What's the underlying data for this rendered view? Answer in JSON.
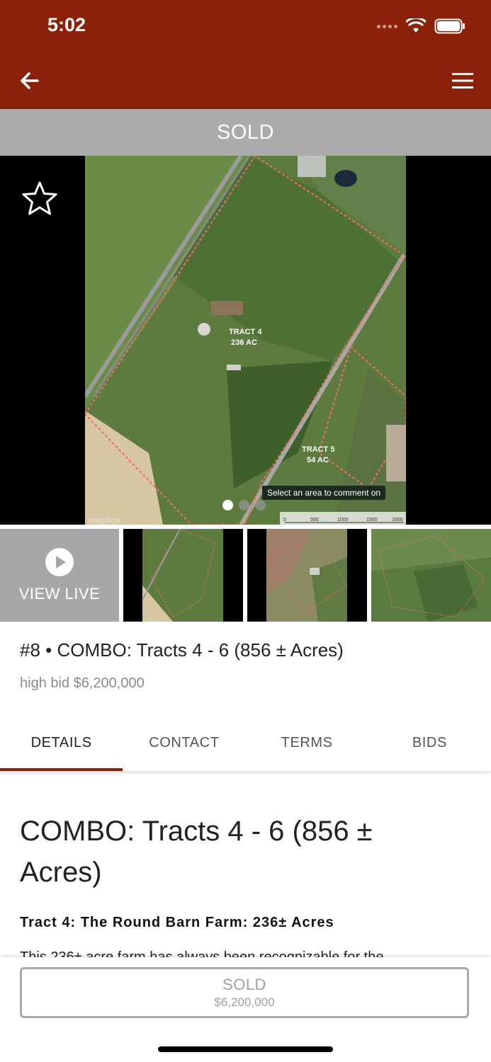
{
  "status_bar": {
    "time": "5:02"
  },
  "header": {
    "back_icon": "arrow-left-icon",
    "menu_icon": "hamburger-menu-icon",
    "color": "#8b2108"
  },
  "banner": {
    "status": "SOLD"
  },
  "hero": {
    "favorite_icon": "star-outline-icon",
    "map_labels": [
      {
        "name": "TRACT 4",
        "acres": "236 AC"
      },
      {
        "name": "TRACT 5",
        "acres": "54 AC"
      }
    ],
    "map_caption": "Select an area to comment on",
    "map_brand": "mapbox",
    "scale_labels": [
      "0",
      "500",
      "1000",
      "1500",
      "2000"
    ],
    "pager": {
      "count": 3,
      "active": 1
    }
  },
  "thumbnails": {
    "view_live_label": "VIEW LIVE",
    "play_icon": "play-circle-icon",
    "count": 3
  },
  "listing": {
    "title": "#8 • COMBO: Tracts 4 - 6 (856 ± Acres)",
    "high_bid": "high bid $6,200,000"
  },
  "tabs": [
    {
      "label": "DETAILS",
      "active": true
    },
    {
      "label": "CONTACT",
      "active": false
    },
    {
      "label": "TERMS",
      "active": false
    },
    {
      "label": "BIDS",
      "active": false
    }
  ],
  "content": {
    "heading": "COMBO: Tracts 4 - 6 (856 ± Acres)",
    "subheading": "Tract 4: The Round Barn Farm: 236± Acres",
    "body_start": "This 236± acre farm has always been recognizable for the"
  },
  "bottom_button": {
    "label": "SOLD",
    "amount": "$6,200,000"
  }
}
